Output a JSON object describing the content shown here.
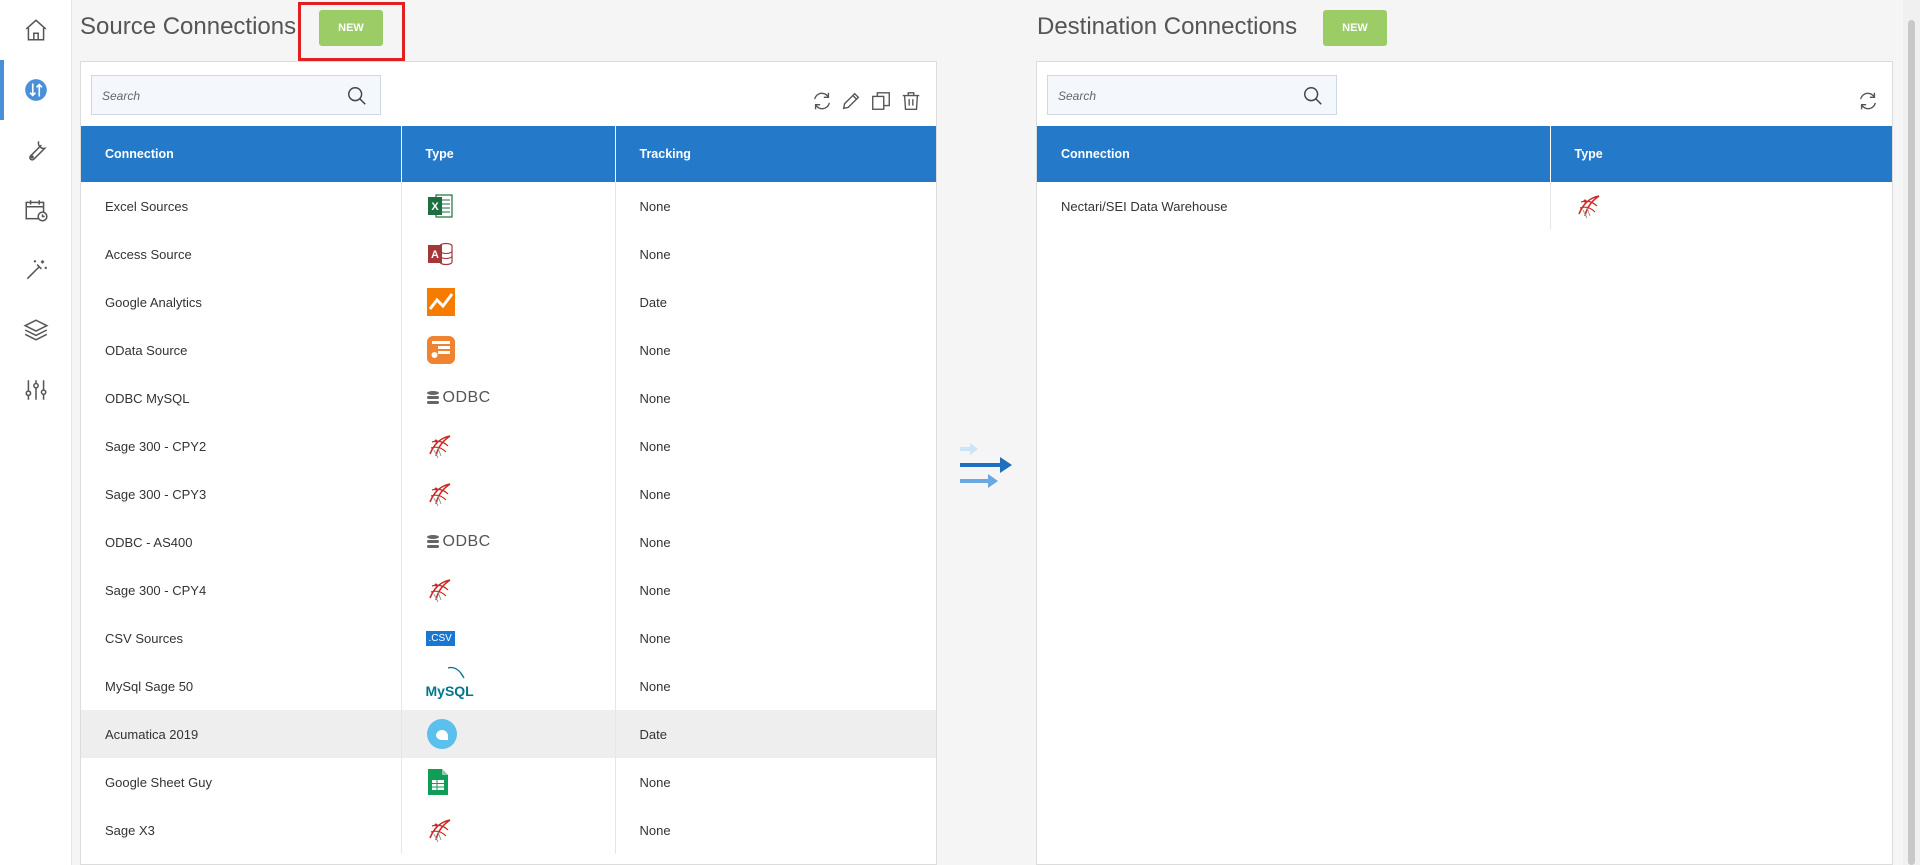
{
  "nav": [
    {
      "icon": "home-icon"
    },
    {
      "icon": "data-transfer-icon",
      "active": true
    },
    {
      "icon": "wrench-icon"
    },
    {
      "icon": "schedule-calendar-icon"
    },
    {
      "icon": "magic-wand-icon"
    },
    {
      "icon": "layers-icon"
    },
    {
      "icon": "settings-sliders-icon"
    }
  ],
  "source": {
    "title": "Source Connections",
    "new_label": "NEW",
    "search_placeholder": "Search",
    "columns": [
      "Connection",
      "Type",
      "Tracking"
    ],
    "rows": [
      {
        "connection": "Excel Sources",
        "type_icon": "excel-icon",
        "tracking": "None"
      },
      {
        "connection": "Access Source",
        "type_icon": "access-icon",
        "tracking": "None"
      },
      {
        "connection": "Google Analytics",
        "type_icon": "google-analytics-icon",
        "tracking": "Date"
      },
      {
        "connection": "OData Source",
        "type_icon": "odata-icon",
        "tracking": "None"
      },
      {
        "connection": "ODBC MySQL",
        "type_icon": "odbc-icon",
        "type_text": "ODBC",
        "tracking": "None"
      },
      {
        "connection": "Sage 300 - CPY2",
        "type_icon": "sql-server-icon",
        "tracking": "None"
      },
      {
        "connection": "Sage 300 - CPY3",
        "type_icon": "sql-server-icon",
        "tracking": "None"
      },
      {
        "connection": "ODBC - AS400",
        "type_icon": "odbc-icon",
        "type_text": "ODBC",
        "tracking": "None"
      },
      {
        "connection": "Sage 300 - CPY4",
        "type_icon": "sql-server-icon",
        "tracking": "None"
      },
      {
        "connection": "CSV Sources",
        "type_icon": "csv-icon",
        "type_text": ".CSV",
        "tracking": "None"
      },
      {
        "connection": "MySql Sage 50",
        "type_icon": "mysql-icon",
        "type_text": "MySQL",
        "tracking": "None"
      },
      {
        "connection": "Acumatica 2019",
        "type_icon": "acumatica-icon",
        "tracking": "Date",
        "selected": true
      },
      {
        "connection": "Google Sheet Guy",
        "type_icon": "google-sheets-icon",
        "tracking": "None"
      },
      {
        "connection": "Sage X3",
        "type_icon": "sql-server-icon",
        "tracking": "None"
      }
    ]
  },
  "destination": {
    "title": "Destination Connections",
    "new_label": "NEW",
    "search_placeholder": "Search",
    "columns": [
      "Connection",
      "Type"
    ],
    "rows": [
      {
        "connection": "Nectari/SEI Data Warehouse",
        "type_icon": "sql-server-icon"
      }
    ]
  },
  "colors": {
    "header_blue": "#2479c9",
    "new_green": "#9ccc65",
    "highlight_red": "#e02020",
    "active_nav": "#4a90d9"
  }
}
